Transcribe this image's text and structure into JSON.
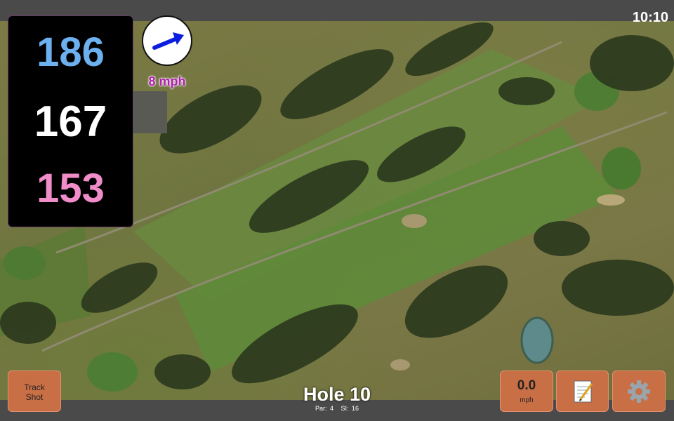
{
  "status": {
    "time": "10:10"
  },
  "distances": {
    "back": "186",
    "middle": "167",
    "front": "153"
  },
  "wind": {
    "speed_text": "8 mph",
    "direction_icon": "arrow-icon"
  },
  "buttons": {
    "track_shot_line1": "Track",
    "track_shot_line2": "Shot",
    "speed_value": "0.0",
    "speed_unit": "mph",
    "notes_icon": "notepad-icon",
    "settings_icon": "gear-icon"
  },
  "hole": {
    "title": "Hole 10",
    "par": "Par: 4",
    "si": "SI: 16"
  },
  "colors": {
    "back": "#6cb0f0",
    "middle": "#ffffff",
    "front": "#f08cc8",
    "wind": "#b020b0",
    "button": "#c96f45"
  }
}
